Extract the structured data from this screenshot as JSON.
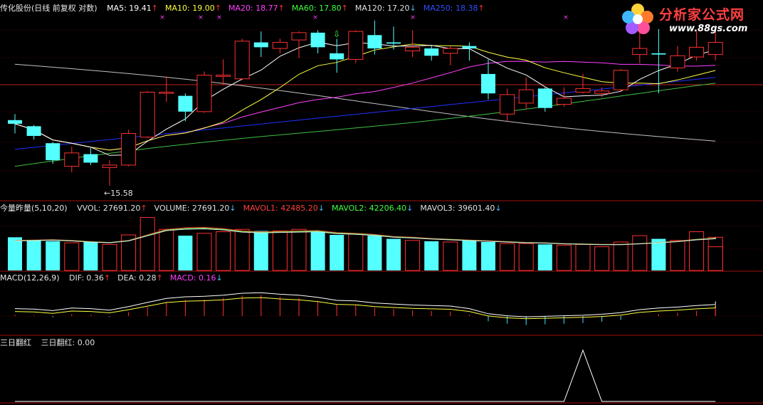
{
  "header_price": {
    "title": "传化股份(日线 前复权 对数)",
    "items": [
      {
        "label": "MA5: 19.41",
        "color": "#ffffff",
        "arrow": "up"
      },
      {
        "label": "MA10: 19.00",
        "color": "#ffff40",
        "arrow": "up"
      },
      {
        "label": "MA20: 18.77",
        "color": "#ff40ff",
        "arrow": "up"
      },
      {
        "label": "MA60: 17.80",
        "color": "#40ff40",
        "arrow": "up"
      },
      {
        "label": "MA120: 17.20",
        "color": "#e0e0e0",
        "arrow": "down"
      },
      {
        "label": "MA250: 18.38",
        "color": "#3050ff",
        "arrow": "up"
      }
    ]
  },
  "header_volume": {
    "title": "今量昨量(5,10,20)",
    "items": [
      {
        "label": "VVOL: 27691.20",
        "color": "#e0e0e0",
        "arrow": "up"
      },
      {
        "label": "VOLUME: 27691.20",
        "color": "#e0e0e0",
        "arrow": "down"
      },
      {
        "label": "MAVOL1: 42485.20",
        "color": "#ff4040",
        "arrow": "down"
      },
      {
        "label": "MAVOL2: 42206.40",
        "color": "#40ff40",
        "arrow": "down"
      },
      {
        "label": "MAVOL3: 39601.40",
        "color": "#e0e0e0",
        "arrow": "down"
      }
    ]
  },
  "header_macd": {
    "title": "MACD(12,26,9)",
    "items": [
      {
        "label": "DIF: 0.36",
        "color": "#e0e0e0",
        "arrow": "up"
      },
      {
        "label": "DEA: 0.28",
        "color": "#e0e0e0",
        "arrow": "up"
      },
      {
        "label": "MACD: 0.16",
        "color": "#ff40ff",
        "arrow": "down"
      }
    ]
  },
  "header_indicator": {
    "title": "三日翻红",
    "items": [
      {
        "label": "三日翻红: 0.00",
        "color": "#e0e0e0",
        "arrow": ""
      }
    ]
  },
  "low_label": "←15.58",
  "logo": {
    "brand": "分析家公式网",
    "url": "www.88gs.com"
  },
  "colors": {
    "up": "#ff3030",
    "down": "#54ffff",
    "ma5": "#ffffff",
    "ma10": "#ffff40",
    "ma20": "#ff40ff",
    "ma60": "#40c040",
    "ma120": "#c0c0c0",
    "ma250": "#2030ff"
  },
  "chart_data": {
    "type": "candlestick",
    "candles": [
      {
        "o": 19.1,
        "c": 18.95,
        "h": 19.35,
        "l": 18.55
      },
      {
        "o": 18.85,
        "c": 18.45,
        "h": 18.9,
        "l": 18.3
      },
      {
        "o": 18.15,
        "c": 17.45,
        "h": 18.2,
        "l": 17.3
      },
      {
        "o": 17.2,
        "c": 17.75,
        "h": 18.0,
        "l": 16.95
      },
      {
        "o": 17.7,
        "c": 17.35,
        "h": 17.95,
        "l": 17.25
      },
      {
        "o": 17.15,
        "c": 17.25,
        "h": 17.45,
        "l": 16.4
      },
      {
        "o": 17.25,
        "c": 18.55,
        "h": 18.7,
        "l": 17.2
      },
      {
        "o": 18.4,
        "c": 20.25,
        "h": 20.3,
        "l": 18.35
      },
      {
        "o": 20.2,
        "c": 20.25,
        "h": 20.9,
        "l": 19.85
      },
      {
        "o": 20.1,
        "c": 19.45,
        "h": 20.2,
        "l": 19.05
      },
      {
        "o": 19.45,
        "c": 20.95,
        "h": 21.1,
        "l": 19.4
      },
      {
        "o": 20.9,
        "c": 20.95,
        "h": 21.6,
        "l": 20.55
      },
      {
        "o": 20.8,
        "c": 22.35,
        "h": 22.45,
        "l": 20.75
      },
      {
        "o": 22.3,
        "c": 22.1,
        "h": 22.75,
        "l": 21.7
      },
      {
        "o": 22.05,
        "c": 22.3,
        "h": 22.45,
        "l": 21.85
      },
      {
        "o": 22.4,
        "c": 22.7,
        "h": 22.75,
        "l": 21.65
      },
      {
        "o": 22.7,
        "c": 22.1,
        "h": 22.8,
        "l": 21.85
      },
      {
        "o": 21.85,
        "c": 21.6,
        "h": 22.45,
        "l": 21.05
      },
      {
        "o": 21.6,
        "c": 22.75,
        "h": 22.8,
        "l": 21.45
      },
      {
        "o": 22.6,
        "c": 22.05,
        "h": 23.2,
        "l": 21.8
      },
      {
        "o": 22.3,
        "c": 22.25,
        "h": 22.95,
        "l": 22.0
      },
      {
        "o": 21.95,
        "c": 22.1,
        "h": 22.8,
        "l": 21.7
      },
      {
        "o": 22.05,
        "c": 21.75,
        "h": 22.15,
        "l": 21.55
      },
      {
        "o": 21.85,
        "c": 22.05,
        "h": 22.15,
        "l": 21.35
      },
      {
        "o": 22.15,
        "c": 22.05,
        "h": 22.3,
        "l": 21.55
      },
      {
        "o": 21.0,
        "c": 20.2,
        "h": 21.6,
        "l": 19.95
      },
      {
        "o": 19.35,
        "c": 20.15,
        "h": 20.4,
        "l": 19.05
      },
      {
        "o": 19.8,
        "c": 20.35,
        "h": 20.85,
        "l": 19.55
      },
      {
        "o": 20.4,
        "c": 19.6,
        "h": 20.45,
        "l": 19.45
      },
      {
        "o": 19.75,
        "c": 20.0,
        "h": 20.45,
        "l": 19.65
      },
      {
        "o": 20.25,
        "c": 20.4,
        "h": 21.0,
        "l": 20.2
      },
      {
        "o": 20.2,
        "c": 20.3,
        "h": 20.45,
        "l": 20.05
      },
      {
        "o": 20.35,
        "c": 21.15,
        "h": 21.2,
        "l": 20.3
      },
      {
        "o": 21.8,
        "c": 22.05,
        "h": 22.8,
        "l": 21.45
      },
      {
        "o": 21.85,
        "c": 21.8,
        "h": 22.85,
        "l": 20.2
      },
      {
        "o": 21.25,
        "c": 21.75,
        "h": 22.15,
        "l": 21.1
      },
      {
        "o": 21.7,
        "c": 22.1,
        "h": 22.8,
        "l": 21.55
      },
      {
        "o": 21.8,
        "c": 22.3,
        "h": 23.0,
        "l": 21.55
      }
    ],
    "volumes": [
      42000,
      38500,
      37000,
      35000,
      36000,
      33000,
      45000,
      67000,
      52000,
      44000,
      47000,
      49000,
      52000,
      50000,
      50000,
      52000,
      49000,
      45000,
      46000,
      44000,
      40000,
      38000,
      37000,
      36000,
      38000,
      36000,
      34000,
      34000,
      33000,
      32000,
      33000,
      30000,
      36000,
      44000,
      40000,
      38000,
      49000,
      42000,
      30000
    ],
    "ma_volume": {
      "mavol1": [
        38000,
        38500,
        39000,
        38000,
        36500,
        35500,
        38000,
        45000,
        52000,
        54000,
        54500,
        53000,
        50000,
        49000,
        49500,
        50000,
        50500,
        48000,
        47000,
        45500,
        43000,
        42000,
        40500,
        39500,
        38500,
        37500,
        36500,
        35500,
        35000,
        34000,
        33500,
        33000,
        33000,
        34000,
        35500,
        37000,
        39500,
        41000,
        42485
      ]
    },
    "macd_hist": [
      0.02,
      0.01,
      -0.02,
      0.03,
      0.02,
      -0.01,
      0.06,
      0.14,
      0.22,
      0.25,
      0.26,
      0.28,
      0.32,
      0.33,
      0.3,
      0.28,
      0.24,
      0.18,
      0.17,
      0.13,
      0.11,
      0.09,
      0.08,
      0.07,
      0.02,
      -0.08,
      -0.12,
      -0.14,
      -0.13,
      -0.12,
      -0.11,
      -0.09,
      -0.06,
      0.0,
      0.03,
      0.05,
      0.08,
      0.1,
      0.16
    ],
    "signal": [
      0,
      0,
      0,
      0,
      0,
      0,
      0,
      0,
      0,
      0,
      0,
      0,
      0,
      0,
      0,
      0,
      0,
      0,
      0,
      0,
      0,
      0,
      0,
      0,
      0,
      0,
      0,
      0,
      0,
      0,
      1,
      0,
      0,
      0,
      0,
      0,
      0,
      0,
      0
    ]
  }
}
